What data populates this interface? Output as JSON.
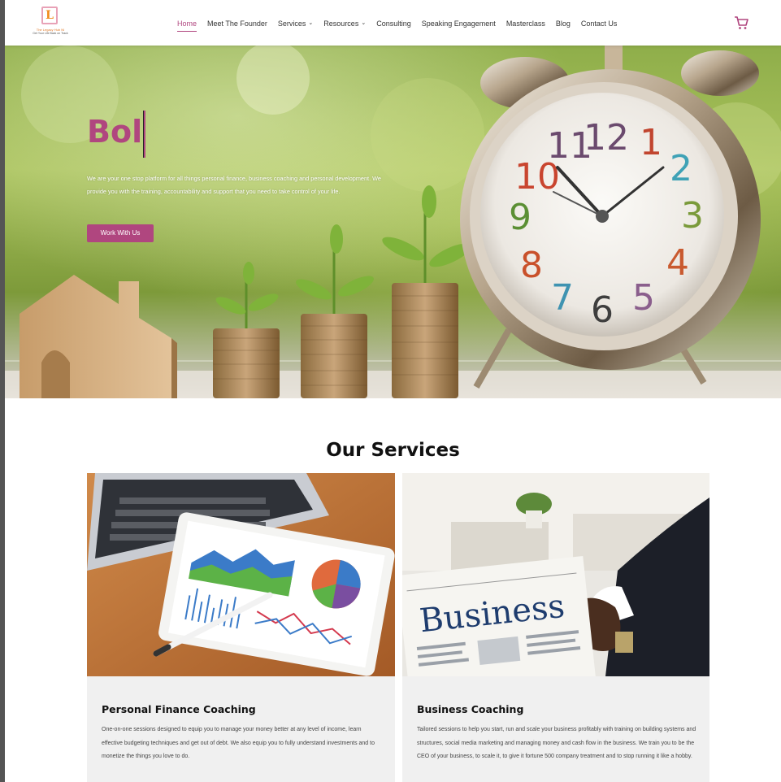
{
  "header": {
    "logo": {
      "letter": "L",
      "name": "The Legacy Hub NI",
      "tagline": "Get Your Life Back on Track"
    },
    "nav": [
      {
        "label": "Home",
        "active": true,
        "has_dropdown": false
      },
      {
        "label": "Meet The Founder",
        "active": false,
        "has_dropdown": false
      },
      {
        "label": "Services",
        "active": false,
        "has_dropdown": true
      },
      {
        "label": "Resources",
        "active": false,
        "has_dropdown": true
      },
      {
        "label": "Consulting",
        "active": false,
        "has_dropdown": false
      },
      {
        "label": "Speaking Engagement",
        "active": false,
        "has_dropdown": false
      },
      {
        "label": "Masterclass",
        "active": false,
        "has_dropdown": false
      },
      {
        "label": "Blog",
        "active": false,
        "has_dropdown": false
      },
      {
        "label": "Contact Us",
        "active": false,
        "has_dropdown": false
      }
    ],
    "cart_icon": "cart-icon"
  },
  "hero": {
    "title": "Bol",
    "description": "We are your one stop platform for all things personal finance, business coaching and personal development. We provide you with the training, accountability and support that you need to take control of your life.",
    "button_label": "Work With Us",
    "clock_numbers": [
      "12",
      "1",
      "2",
      "3",
      "4",
      "5",
      "6",
      "7",
      "8",
      "9",
      "10",
      "11"
    ]
  },
  "services": {
    "title": "Our Services",
    "cards": [
      {
        "title": "Personal Finance Coaching",
        "text": "One-on-one sessions designed to equip you to manage your money better at any level of income, learn effective budgeting techniques and get out of debt. We also equip you to fully understand investments and to monetize the things you love to do."
      },
      {
        "title": "Business Coaching",
        "text": "Tailored sessions to help you start, run and scale your business profitably with training on building systems and structures, social media marketing and managing money and cash flow in the business. We train you to be the CEO of your business, to scale it, to give it fortune 500 company treatment and to stop running it like a hobby.",
        "newspaper_headline": "Business"
      }
    ]
  },
  "colors": {
    "accent": "#b0467f",
    "logo_orange": "#f08a1a",
    "card_bg": "#f0f0f0"
  }
}
